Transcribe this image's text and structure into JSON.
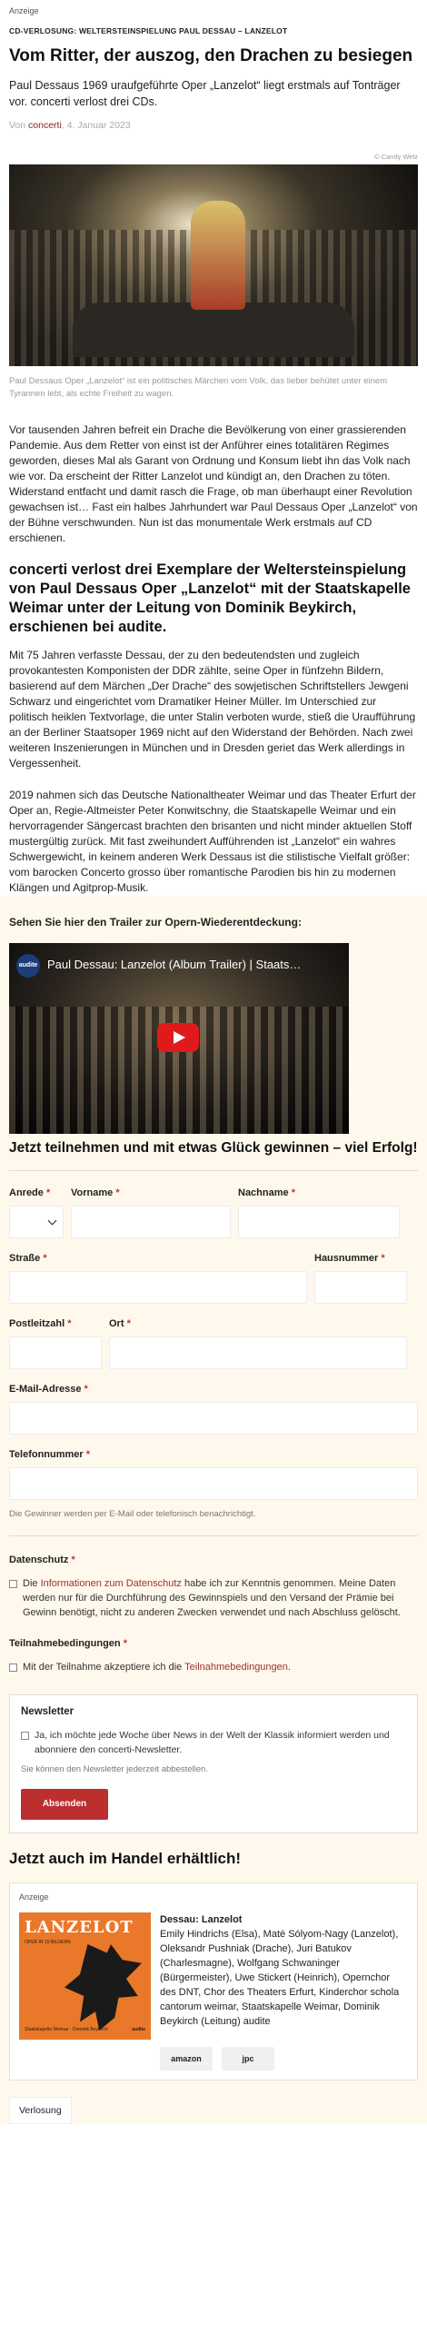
{
  "top_ad_label": "Anzeige",
  "kicker": "CD-VERLOSUNG: WELTERSTEINSPIELUNG PAUL DESSAU – LANZELOT",
  "title": "Vom Ritter, der auszog, den Drachen zu besiegen",
  "lead": "Paul Dessaus 1969 uraufgeführte Oper „Lanzelot“ liegt erstmals auf Tonträger vor. concerti verlost drei CDs.",
  "byline": {
    "prefix": "Von",
    "author": "concerti",
    "date": ", 4. Januar 2023"
  },
  "image_credit": "© Candy Welz",
  "image_caption": "Paul Dessaus Oper „Lanzelot“ ist ein politisches Märchen vom Volk, das lieber behütet unter einem Tyrannen lebt, als echte Freiheit zu wagen.",
  "paragraph1": "Vor tausenden Jahren befreit ein Drache die Bevölkerung von einer grassierenden Pandemie. Aus dem Retter von einst ist der Anführer eines totalitären Regimes geworden, dieses Mal als Garant von Ordnung und Konsum liebt ihn das Volk nach wie vor. Da erscheint der Ritter Lanzelot und kündigt an, den Drachen zu töten. Widerstand entfacht und damit rasch die Frage, ob man überhaupt einer Revolution gewachsen ist… Fast ein halbes Jahrhundert war Paul Dessaus Oper „Lanzelot“ von der Bühne verschwunden. Nun ist das monumentale Werk erstmals auf CD erschienen.",
  "subheading": "concerti verlost drei Exemplare der Weltersteinspielung von Paul Dessaus Oper „Lanzelot“ mit der Staatskapelle Weimar unter der Leitung von Dominik Beykirch, erschienen bei audite.",
  "paragraph2": "Mit 75 Jahren verfasste Dessau, der zu den bedeutendsten und zugleich provokantesten Komponisten der DDR zählte, seine Oper in fünfzehn Bildern, basierend auf dem Märchen „Der Drache“ des sowjetischen Schriftstellers Jewgeni Schwarz und eingerichtet vom Dramatiker Heiner Müller. Im Unterschied zur politisch heiklen Textvorlage, die unter Stalin verboten wurde, stieß die Uraufführung an der Berliner Staatsoper 1969 nicht auf den Widerstand der Behörden. Nach zwei weiteren Inszenierungen in München und in Dresden geriet das Werk allerdings in Vergessenheit.",
  "paragraph3": "2019 nahmen sich das Deutsche Nationaltheater Weimar und das Theater Erfurt der Oper an, Regie-Altmeister Peter Konwitschny, die Staatskapelle Weimar und ein hervorragender Sängercast brachten den brisanten und nicht minder aktuellen Stoff mustergültig zurück. Mit fast zweihundert Aufführenden ist „Lanzelot“ ein wahres Schwergewicht, in keinem anderen Werk Dessaus ist die stilistische Vielfalt größer: vom barocken Concerto grosso über romantische Parodien bis hin zu modernen Klängen und Agitprop-Musik.",
  "trailer_heading": "Sehen Sie hier den Trailer zur Opern-Wiederentdeckung:",
  "video": {
    "channel_logo": "audite",
    "title": "Paul Dessau: Lanzelot (Album Trailer) | Staats…"
  },
  "contest_heading": "Jetzt teilnehmen und mit etwas Glück gewinnen – viel Erfolg!",
  "form": {
    "anrede_label": "Anrede",
    "vorname_label": "Vorname",
    "nachname_label": "Nachname",
    "strasse_label": "Straße",
    "hausnummer_label": "Hausnummer",
    "plz_label": "Postleitzahl",
    "ort_label": "Ort",
    "email_label": "E-Mail-Adresse",
    "telefon_label": "Telefonnummer",
    "required_mark": "*",
    "winner_hint": "Die Gewinner werden per E-Mail oder telefonisch benachrichtigt.",
    "datenschutz_label": "Datenschutz",
    "datenschutz_pre": "Die",
    "datenschutz_link": "Informationen zum Datenschutz",
    "datenschutz_post": "habe ich zur Kenntnis genommen. Meine Daten werden nur für die Durchführung des Gewinnspiels und den Versand der Prämie bei Gewinn benötigt, nicht zu anderen Zwecken verwendet und nach Abschluss gelöscht.",
    "teilnahme_label": "Teilnahmebedingungen",
    "teilnahme_pre": "Mit der Teilnahme akzeptiere ich die",
    "teilnahme_link": "Teilnahmebedingungen",
    "teilnahme_post": "."
  },
  "newsletter": {
    "title": "Newsletter",
    "checkbox_text": "Ja, ich möchte jede Woche über News in der Welt der Klassik informiert werden und abonniere den concerti-Newsletter.",
    "hint": "Sie können den Newsletter jederzeit abbestellen.",
    "submit_label": "Absenden"
  },
  "shop_heading": "Jetzt auch im Handel erhältlich!",
  "shop_ad": {
    "label": "Anzeige",
    "cover_title": "LANZELOT",
    "cover_subtitle": "OPER IN 15 BILDERN",
    "cover_footer": "Staatskapelle Weimar · Dominik Beykirch",
    "cover_label": "audite",
    "product_title": "Dessau: Lanzelot",
    "product_text": "Emily Hindrichs (Elsa), Maté Sólyom-Nagy (Lanzelot), Oleksandr Pushniak (Drache), Juri Batukov (Charlesmagne), Wolfgang Schwaninger (Bürgermeister), Uwe Stickert (Heinrich), Opernchor des DNT, Chor des Theaters Erfurt, Kinderchor schola cantorum weimar, Staatskapelle Weimar, Dominik Beykirch (Leitung) audite",
    "shop1": "amazon",
    "shop2": "jpc"
  },
  "tag": "Verlosung"
}
